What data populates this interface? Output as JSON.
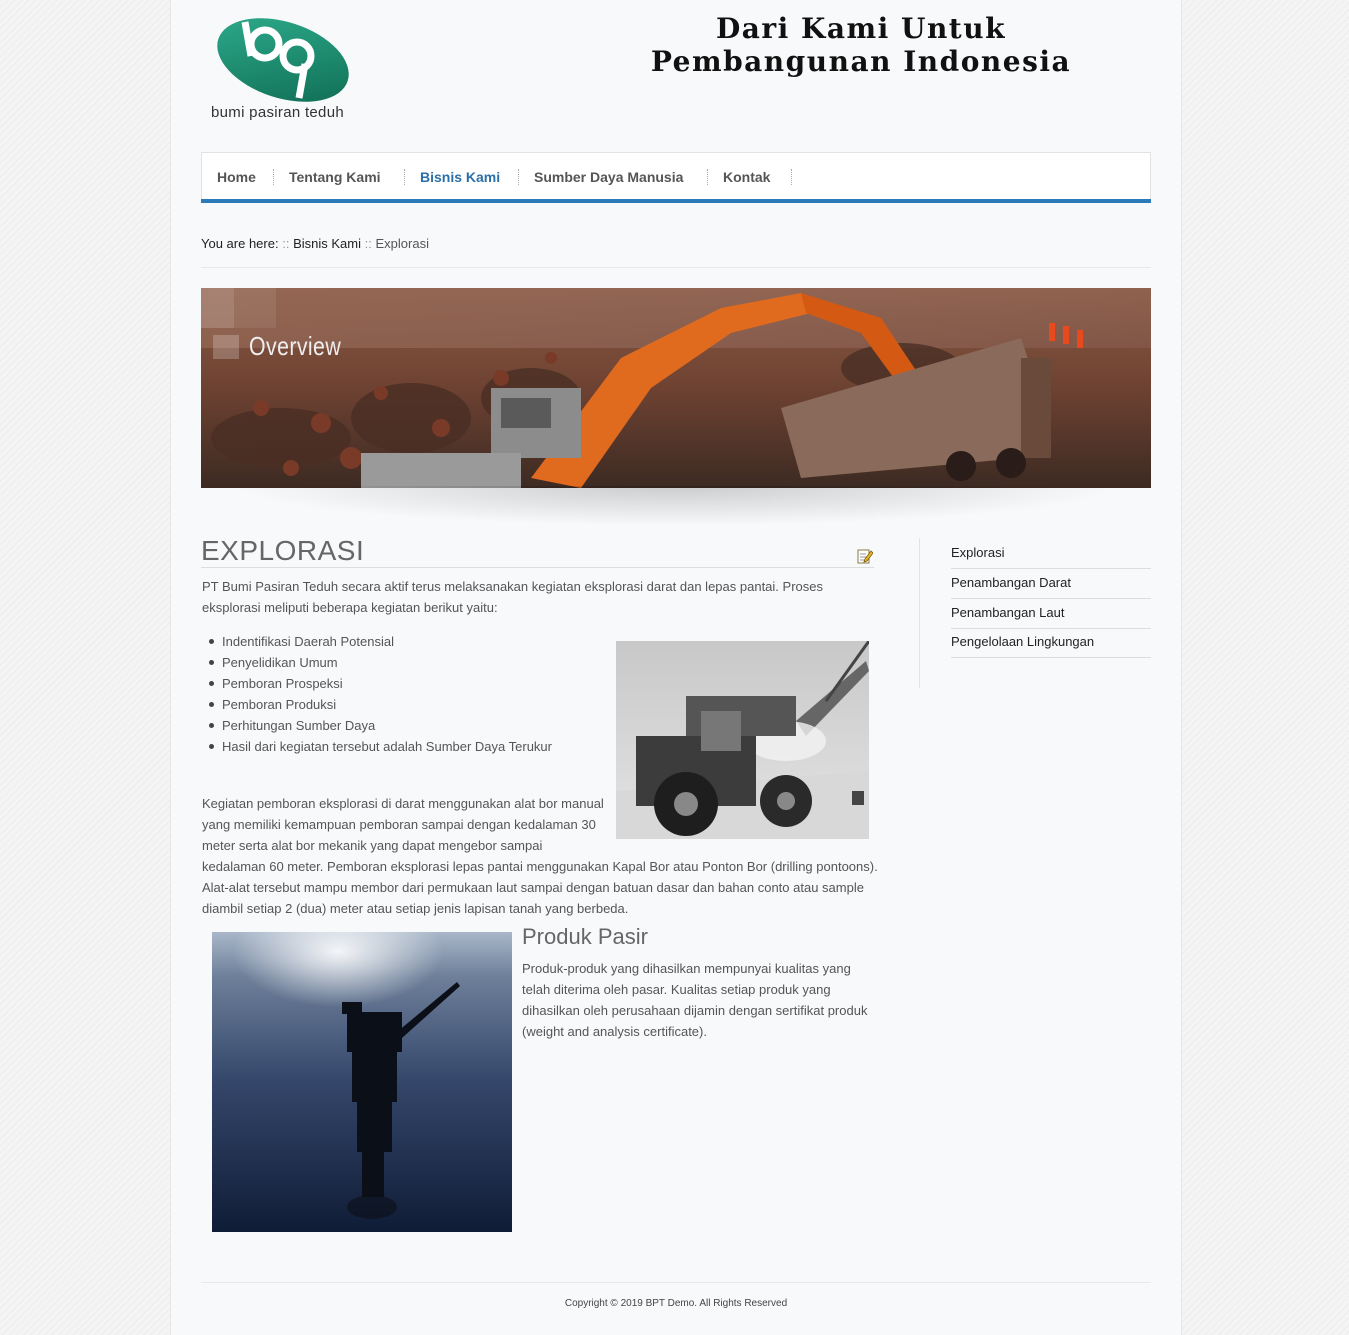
{
  "header": {
    "logo_text": "bumi pasiran teduh",
    "slogan_line1": "Dari Kami Untuk",
    "slogan_line2": "Pembangunan Indonesia"
  },
  "nav": {
    "items": [
      {
        "label": "Home"
      },
      {
        "label": "Tentang Kami"
      },
      {
        "label": "Bisnis Kami"
      },
      {
        "label": "Sumber Daya Manusia"
      },
      {
        "label": "Kontak"
      }
    ],
    "active": "Bisnis Kami"
  },
  "breadcrumb": {
    "prefix": "You are here:",
    "sep": "::",
    "parent": "Bisnis Kami",
    "current": "Explorasi"
  },
  "banner": {
    "label": "Overview"
  },
  "article": {
    "title": "EXPLORASI",
    "intro": "PT Bumi Pasiran Teduh secara aktif terus melaksanakan kegiatan eksplorasi darat dan lepas pantai. Proses eksplorasi meliputi beberapa kegiatan berikut yaitu:",
    "list": [
      "Indentifikasi Daerah Potensial",
      "Penyelidikan Umum",
      "Pemboran Prospeksi",
      "Pemboran Produksi",
      "Perhitungan Sumber Daya",
      "Hasil dari kegiatan tersebut adalah Sumber Daya Terukur"
    ],
    "para2_a": "Kegiatan pemboran eksplorasi di darat menggunakan alat bor manual yang memiliki kemampuan pemboran sampai dengan kedalaman 30 meter serta alat bor mekanik yang dapat mengebor sampai",
    "para2_b": "kedalaman 60 meter. Pemboran eksplorasi lepas pantai menggunakan Kapal Bor atau Ponton Bor (drilling pontoons). Alat-alat tersebut mampu membor dari permukaan laut sampai dengan batuan dasar dan bahan conto atau sample diambil setiap 2 (dua) meter atau setiap jenis lapisan tanah yang berbeda.",
    "product_title": "Produk Pasir",
    "product_text": "Produk-produk yang dihasilkan mempunyai kualitas yang telah diterima oleh pasar. Kualitas setiap produk yang dihasilkan oleh perusahaan dijamin dengan sertifikat produk (weight and analysis certificate)."
  },
  "sidebar": {
    "items": [
      {
        "label": "Explorasi"
      },
      {
        "label": "Penambangan Darat"
      },
      {
        "label": "Penambangan Laut"
      },
      {
        "label": "Pengelolaan Lingkungan"
      }
    ]
  },
  "footer": {
    "copyright": "Copyright © 2019 BPT Demo. All Rights Reserved"
  },
  "colors": {
    "accent": "#2b7bb9",
    "logo_green": "#1f8a70"
  }
}
